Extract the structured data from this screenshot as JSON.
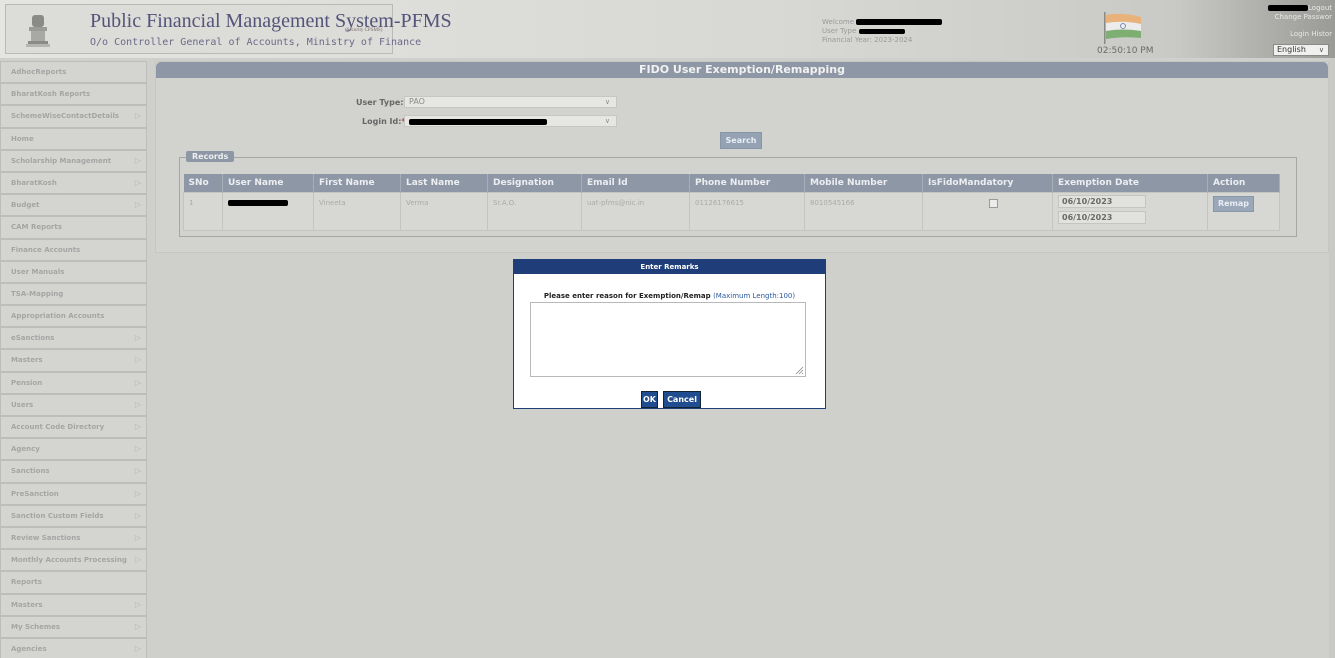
{
  "header": {
    "title": "Public Financial Management System-PFMS",
    "security_tag": "(Security CPSMS)",
    "subtitle": "O/o Controller General of Accounts, Ministry of Finance",
    "welcome_label": "Welcome",
    "user_type_label": "User Type",
    "financial_year": "Financial Year: 2023-2024",
    "clock": "02:50:10 PM",
    "links": {
      "logout": "Logout",
      "change_password": "Change Passwor",
      "login_history": "Login Histor"
    },
    "language": "English"
  },
  "sidebar": {
    "items": [
      {
        "label": "AdhocReports",
        "has_submenu": false
      },
      {
        "label": "BharatKosh Reports",
        "has_submenu": false
      },
      {
        "label": "SchemeWiseContactDetails",
        "has_submenu": true
      },
      {
        "label": "Home",
        "has_submenu": false
      },
      {
        "label": "Scholarship Management",
        "has_submenu": true
      },
      {
        "label": "BharatKosh",
        "has_submenu": true
      },
      {
        "label": "Budget",
        "has_submenu": true
      },
      {
        "label": "CAM Reports",
        "has_submenu": false
      },
      {
        "label": "Finance Accounts",
        "has_submenu": false
      },
      {
        "label": "User Manuals",
        "has_submenu": false
      },
      {
        "label": "TSA-Mapping",
        "has_submenu": false
      },
      {
        "label": "Appropriation Accounts",
        "has_submenu": false
      },
      {
        "label": "eSanctions",
        "has_submenu": true
      },
      {
        "label": "Masters",
        "has_submenu": true
      },
      {
        "label": "Pension",
        "has_submenu": true
      },
      {
        "label": "Users",
        "has_submenu": true
      },
      {
        "label": "Account Code Directory",
        "has_submenu": true
      },
      {
        "label": "Agency",
        "has_submenu": true
      },
      {
        "label": "Sanctions",
        "has_submenu": true
      },
      {
        "label": "PreSanction",
        "has_submenu": true
      },
      {
        "label": "Sanction Custom Fields",
        "has_submenu": true
      },
      {
        "label": "Review Sanctions",
        "has_submenu": true
      },
      {
        "label": "Monthly Accounts Processing",
        "has_submenu": true
      },
      {
        "label": "Reports",
        "has_submenu": false
      },
      {
        "label": "Masters",
        "has_submenu": true
      },
      {
        "label": "My Schemes",
        "has_submenu": true
      },
      {
        "label": "Agencies",
        "has_submenu": true
      }
    ],
    "submenu_arrow": "▷"
  },
  "main": {
    "title": "FIDO User Exemption/Remapping",
    "user_type_label": "User Type:",
    "user_type_value": "PAO",
    "login_id_label": "Login Id:",
    "required_mark": "*",
    "search_label": "Search",
    "records_legend": "Records",
    "columns": [
      "SNo",
      "User Name",
      "First Name",
      "Last Name",
      "Designation",
      "Email Id",
      "Phone Number",
      "Mobile Number",
      "IsFidoMandatory",
      "Exemption Date",
      "Action"
    ],
    "rows": [
      {
        "sno": "1",
        "first_name": "Vineeta",
        "last_name": "Verma",
        "designation": "Sr.A.O.",
        "email": "uat-pfms@nic.in",
        "phone": "01126176615",
        "mobile": "8010545166",
        "is_fido_mandatory": false,
        "exemption_date_1": "06/10/2023",
        "exemption_date_2": "06/10/2023",
        "action_label": "Remap"
      }
    ]
  },
  "modal": {
    "title": "Enter Remarks",
    "prompt": "Please enter reason for Exemption/Remap",
    "hint": "(Maximum Length:100)",
    "textarea_value": "",
    "ok_label": "OK",
    "cancel_label": "Cancel"
  },
  "colors": {
    "modal_title_bg": "#1f3d78",
    "panel_header_bg": "#8e97a5",
    "button_primary": "#1f4d8f"
  }
}
